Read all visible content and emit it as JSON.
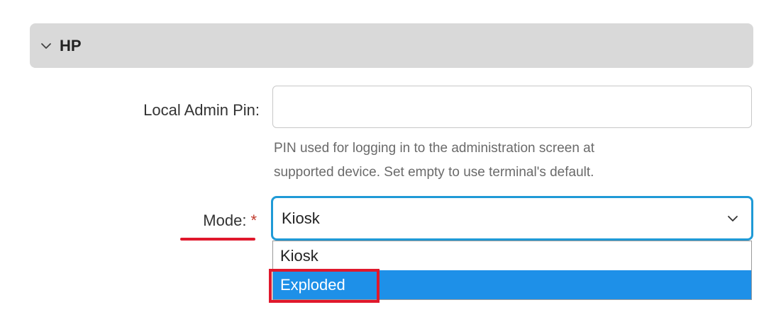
{
  "section": {
    "title": "HP",
    "icon": "chevron-down-icon"
  },
  "local_admin_pin": {
    "label": "Local Admin Pin:",
    "value": "",
    "placeholder": "",
    "help_line1": "PIN used for logging in to the administration screen at",
    "help_line2": "supported device. Set empty to use terminal's default."
  },
  "mode": {
    "label": "Mode:",
    "required_marker": "*",
    "selected_value": "Kiosk",
    "icon": "chevron-down-icon",
    "options": [
      {
        "label": "Kiosk",
        "highlighted": false
      },
      {
        "label": "Exploded",
        "highlighted": true
      }
    ]
  },
  "colors": {
    "focus_border": "#1f9ad6",
    "highlight": "#1e90e8",
    "annotation_red": "#e0182c",
    "section_bg": "#d9d9d9"
  }
}
